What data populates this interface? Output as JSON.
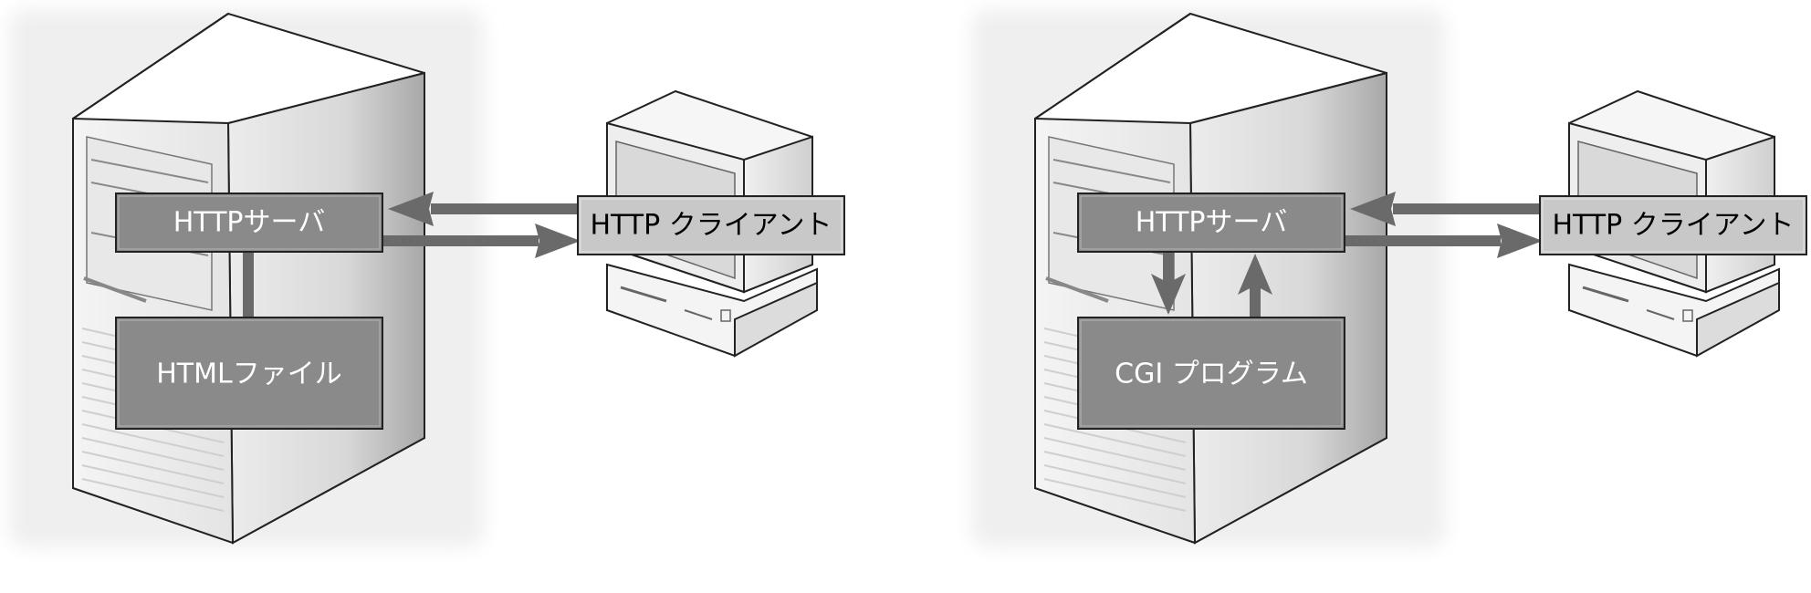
{
  "colors": {
    "box_dark": "#8a8a8a",
    "box_light": "#c8c8c8",
    "arrow": "#6a6a6a",
    "shadow_bg": "#efefef"
  },
  "left": {
    "server_label": "HTTPサーバ",
    "file_label": "HTMLファイル",
    "client_label": "HTTP クライアント"
  },
  "right": {
    "server_label": "HTTPサーバ",
    "program_label": "CGI プログラム",
    "client_label": "HTTP クライアント"
  }
}
